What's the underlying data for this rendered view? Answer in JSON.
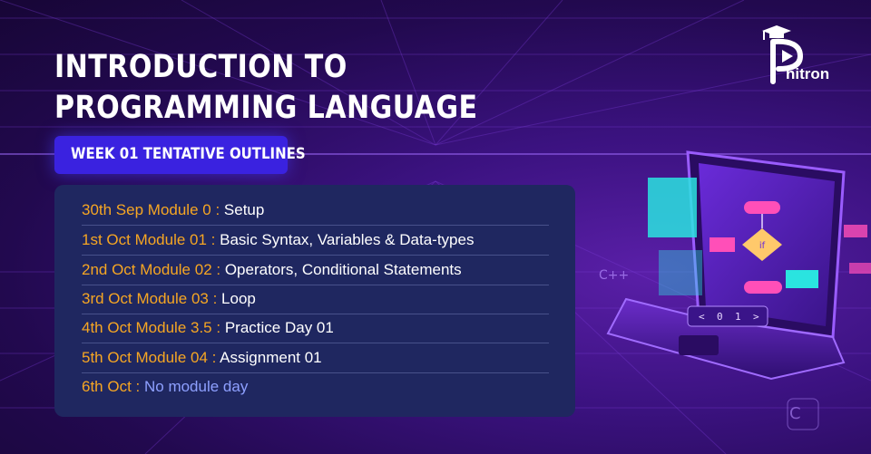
{
  "title_lines": [
    "INTRODUCTION TO",
    "PROGRAMMING LANGUAGE"
  ],
  "week_badge": "WEEK 01 TENTATIVE OUTLINES",
  "outline": [
    {
      "label": "30th Sep Module 0 :",
      "desc": "Setup"
    },
    {
      "label": "1st Oct Module 01 :",
      "desc": "Basic Syntax, Variables & Data-types"
    },
    {
      "label": "2nd Oct Module 02 :",
      "desc": "Operators, Conditional Statements"
    },
    {
      "label": "3rd Oct Module 03 :",
      "desc": "Loop"
    },
    {
      "label": "4th Oct Module 3.5 :",
      "desc": "Practice Day 01"
    },
    {
      "label": "5th Oct Module 04 :",
      "desc": "Assignment 01"
    },
    {
      "label": "6th Oct :",
      "desc": "No module day"
    }
  ],
  "brand": {
    "name": "hitron",
    "icon": "graduation-cap-play-logo"
  },
  "illustration": {
    "if_label": "if",
    "key_labels": [
      "<",
      "0",
      "1",
      ">"
    ],
    "floating_text": [
      "C++",
      "C"
    ]
  },
  "colors": {
    "label": "#f6a623",
    "desc": "#ffffff",
    "muted": "#8ea0ff",
    "badge": "#3a22e0",
    "card": "#1f2760"
  }
}
